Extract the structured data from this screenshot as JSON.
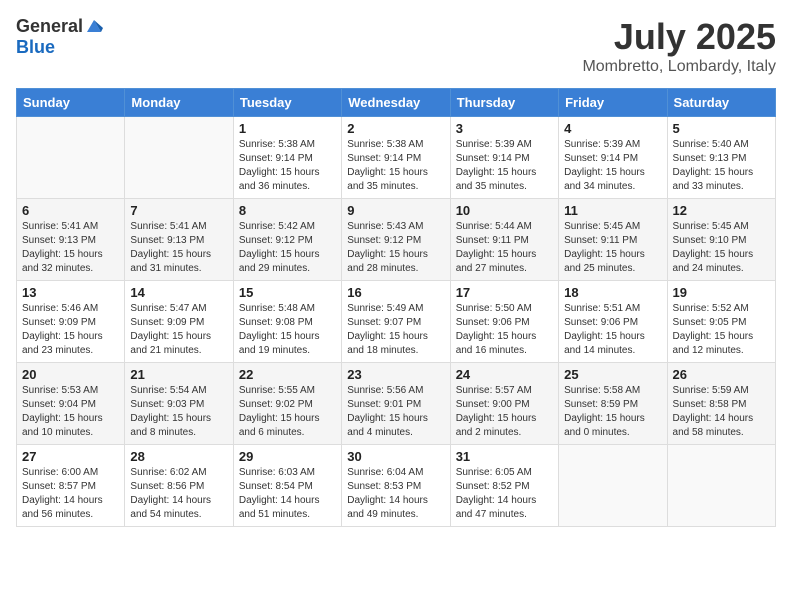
{
  "header": {
    "logo_general": "General",
    "logo_blue": "Blue",
    "month": "July 2025",
    "location": "Mombretto, Lombardy, Italy"
  },
  "days_of_week": [
    "Sunday",
    "Monday",
    "Tuesday",
    "Wednesday",
    "Thursday",
    "Friday",
    "Saturday"
  ],
  "weeks": [
    [
      {
        "day": "",
        "detail": ""
      },
      {
        "day": "",
        "detail": ""
      },
      {
        "day": "1",
        "detail": "Sunrise: 5:38 AM\nSunset: 9:14 PM\nDaylight: 15 hours\nand 36 minutes."
      },
      {
        "day": "2",
        "detail": "Sunrise: 5:38 AM\nSunset: 9:14 PM\nDaylight: 15 hours\nand 35 minutes."
      },
      {
        "day": "3",
        "detail": "Sunrise: 5:39 AM\nSunset: 9:14 PM\nDaylight: 15 hours\nand 35 minutes."
      },
      {
        "day": "4",
        "detail": "Sunrise: 5:39 AM\nSunset: 9:14 PM\nDaylight: 15 hours\nand 34 minutes."
      },
      {
        "day": "5",
        "detail": "Sunrise: 5:40 AM\nSunset: 9:13 PM\nDaylight: 15 hours\nand 33 minutes."
      }
    ],
    [
      {
        "day": "6",
        "detail": "Sunrise: 5:41 AM\nSunset: 9:13 PM\nDaylight: 15 hours\nand 32 minutes."
      },
      {
        "day": "7",
        "detail": "Sunrise: 5:41 AM\nSunset: 9:13 PM\nDaylight: 15 hours\nand 31 minutes."
      },
      {
        "day": "8",
        "detail": "Sunrise: 5:42 AM\nSunset: 9:12 PM\nDaylight: 15 hours\nand 29 minutes."
      },
      {
        "day": "9",
        "detail": "Sunrise: 5:43 AM\nSunset: 9:12 PM\nDaylight: 15 hours\nand 28 minutes."
      },
      {
        "day": "10",
        "detail": "Sunrise: 5:44 AM\nSunset: 9:11 PM\nDaylight: 15 hours\nand 27 minutes."
      },
      {
        "day": "11",
        "detail": "Sunrise: 5:45 AM\nSunset: 9:11 PM\nDaylight: 15 hours\nand 25 minutes."
      },
      {
        "day": "12",
        "detail": "Sunrise: 5:45 AM\nSunset: 9:10 PM\nDaylight: 15 hours\nand 24 minutes."
      }
    ],
    [
      {
        "day": "13",
        "detail": "Sunrise: 5:46 AM\nSunset: 9:09 PM\nDaylight: 15 hours\nand 23 minutes."
      },
      {
        "day": "14",
        "detail": "Sunrise: 5:47 AM\nSunset: 9:09 PM\nDaylight: 15 hours\nand 21 minutes."
      },
      {
        "day": "15",
        "detail": "Sunrise: 5:48 AM\nSunset: 9:08 PM\nDaylight: 15 hours\nand 19 minutes."
      },
      {
        "day": "16",
        "detail": "Sunrise: 5:49 AM\nSunset: 9:07 PM\nDaylight: 15 hours\nand 18 minutes."
      },
      {
        "day": "17",
        "detail": "Sunrise: 5:50 AM\nSunset: 9:06 PM\nDaylight: 15 hours\nand 16 minutes."
      },
      {
        "day": "18",
        "detail": "Sunrise: 5:51 AM\nSunset: 9:06 PM\nDaylight: 15 hours\nand 14 minutes."
      },
      {
        "day": "19",
        "detail": "Sunrise: 5:52 AM\nSunset: 9:05 PM\nDaylight: 15 hours\nand 12 minutes."
      }
    ],
    [
      {
        "day": "20",
        "detail": "Sunrise: 5:53 AM\nSunset: 9:04 PM\nDaylight: 15 hours\nand 10 minutes."
      },
      {
        "day": "21",
        "detail": "Sunrise: 5:54 AM\nSunset: 9:03 PM\nDaylight: 15 hours\nand 8 minutes."
      },
      {
        "day": "22",
        "detail": "Sunrise: 5:55 AM\nSunset: 9:02 PM\nDaylight: 15 hours\nand 6 minutes."
      },
      {
        "day": "23",
        "detail": "Sunrise: 5:56 AM\nSunset: 9:01 PM\nDaylight: 15 hours\nand 4 minutes."
      },
      {
        "day": "24",
        "detail": "Sunrise: 5:57 AM\nSunset: 9:00 PM\nDaylight: 15 hours\nand 2 minutes."
      },
      {
        "day": "25",
        "detail": "Sunrise: 5:58 AM\nSunset: 8:59 PM\nDaylight: 15 hours\nand 0 minutes."
      },
      {
        "day": "26",
        "detail": "Sunrise: 5:59 AM\nSunset: 8:58 PM\nDaylight: 14 hours\nand 58 minutes."
      }
    ],
    [
      {
        "day": "27",
        "detail": "Sunrise: 6:00 AM\nSunset: 8:57 PM\nDaylight: 14 hours\nand 56 minutes."
      },
      {
        "day": "28",
        "detail": "Sunrise: 6:02 AM\nSunset: 8:56 PM\nDaylight: 14 hours\nand 54 minutes."
      },
      {
        "day": "29",
        "detail": "Sunrise: 6:03 AM\nSunset: 8:54 PM\nDaylight: 14 hours\nand 51 minutes."
      },
      {
        "day": "30",
        "detail": "Sunrise: 6:04 AM\nSunset: 8:53 PM\nDaylight: 14 hours\nand 49 minutes."
      },
      {
        "day": "31",
        "detail": "Sunrise: 6:05 AM\nSunset: 8:52 PM\nDaylight: 14 hours\nand 47 minutes."
      },
      {
        "day": "",
        "detail": ""
      },
      {
        "day": "",
        "detail": ""
      }
    ]
  ]
}
